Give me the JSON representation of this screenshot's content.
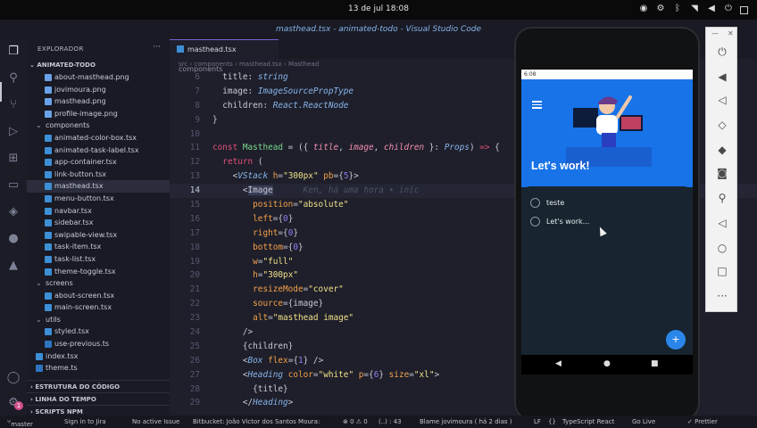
{
  "topbar": {
    "clock": "13 de jul 18:08"
  },
  "window_title": "masthead.tsx - animated-todo - Visual Studio Code",
  "sidebar": {
    "header": "EXPLORADOR",
    "more": "···",
    "project": "ANIMATED-TODO",
    "tree": [
      {
        "label": "about-masthead.png",
        "indent": 20,
        "icon": "png"
      },
      {
        "label": "jovimoura.png",
        "indent": 20,
        "icon": "png"
      },
      {
        "label": "masthead.png",
        "indent": 20,
        "icon": "png"
      },
      {
        "label": "profile-image.png",
        "indent": 20,
        "icon": "png"
      },
      {
        "label": "components",
        "indent": 10,
        "icon": "dir"
      },
      {
        "label": "animated-color-box.tsx",
        "indent": 20,
        "icon": "tsx"
      },
      {
        "label": "animated-task-label.tsx",
        "indent": 20,
        "icon": "tsx"
      },
      {
        "label": "app-container.tsx",
        "indent": 20,
        "icon": "tsx"
      },
      {
        "label": "link-button.tsx",
        "indent": 20,
        "icon": "tsx"
      },
      {
        "label": "masthead.tsx",
        "indent": 20,
        "icon": "tsx",
        "selected": true
      },
      {
        "label": "menu-button.tsx",
        "indent": 20,
        "icon": "tsx"
      },
      {
        "label": "navbar.tsx",
        "indent": 20,
        "icon": "tsx"
      },
      {
        "label": "sidebar.tsx",
        "indent": 20,
        "icon": "tsx"
      },
      {
        "label": "swipable-view.tsx",
        "indent": 20,
        "icon": "tsx"
      },
      {
        "label": "task-item.tsx",
        "indent": 20,
        "icon": "tsx"
      },
      {
        "label": "task-list.tsx",
        "indent": 20,
        "icon": "tsx"
      },
      {
        "label": "theme-toggle.tsx",
        "indent": 20,
        "icon": "tsx"
      },
      {
        "label": "screens",
        "indent": 10,
        "icon": "dir"
      },
      {
        "label": "about-screen.tsx",
        "indent": 20,
        "icon": "tsx"
      },
      {
        "label": "main-screen.tsx",
        "indent": 20,
        "icon": "tsx"
      },
      {
        "label": "utils",
        "indent": 10,
        "icon": "dir"
      },
      {
        "label": "styled.tsx",
        "indent": 20,
        "icon": "tsx"
      },
      {
        "label": "use-previous.ts",
        "indent": 20,
        "icon": "ts"
      },
      {
        "label": "index.tsx",
        "indent": 10,
        "icon": "tsx"
      },
      {
        "label": "theme.ts",
        "indent": 10,
        "icon": "ts"
      }
    ],
    "sections": [
      "ESTRUTURA DO CÓDIGO",
      "LINHA DO TEMPO",
      "SCRIPTS NPM"
    ]
  },
  "editor": {
    "tab_label": "masthead.tsx",
    "tab_path": "components",
    "breadcrumb": "src › components › masthead.tsx › Masthead",
    "current_line": 14,
    "lines": [
      {
        "n": 6,
        "tokens": [
          [
            "p",
            "  title: "
          ],
          [
            "t",
            "string"
          ]
        ]
      },
      {
        "n": 7,
        "tokens": [
          [
            "p",
            "  image: "
          ],
          [
            "t",
            "ImageSourcePropType"
          ]
        ]
      },
      {
        "n": 8,
        "tokens": [
          [
            "p",
            "  children: "
          ],
          [
            "t",
            "React.ReactNode"
          ]
        ]
      },
      {
        "n": 9,
        "tokens": [
          [
            "p",
            "}"
          ]
        ]
      },
      {
        "n": 10,
        "tokens": []
      },
      {
        "n": 11,
        "tokens": [
          [
            "k",
            "const "
          ],
          [
            "f",
            "Masthead"
          ],
          [
            "p",
            " = ({ "
          ],
          [
            "v",
            "title"
          ],
          [
            "p",
            ", "
          ],
          [
            "v",
            "image"
          ],
          [
            "p",
            ", "
          ],
          [
            "v",
            "children"
          ],
          [
            "p",
            " }: "
          ],
          [
            "t",
            "Props"
          ],
          [
            "p",
            ") "
          ],
          [
            "k",
            "=>"
          ],
          [
            "p",
            " {"
          ]
        ]
      },
      {
        "n": 12,
        "tokens": [
          [
            "p",
            "  "
          ],
          [
            "k",
            "return"
          ],
          [
            "p",
            " ("
          ]
        ]
      },
      {
        "n": 13,
        "tokens": [
          [
            "p",
            "    <"
          ],
          [
            "t",
            "VStack"
          ],
          [
            "p",
            " "
          ],
          [
            "a",
            "h"
          ],
          [
            "p",
            "="
          ],
          [
            "s",
            "\"300px\""
          ],
          [
            "p",
            " "
          ],
          [
            "a",
            "pb"
          ],
          [
            "p",
            "={"
          ],
          [
            "tg",
            "5"
          ],
          [
            "p",
            "}>"
          ]
        ]
      },
      {
        "n": 14,
        "tokens": [
          [
            "p",
            "      <"
          ],
          [
            "hl",
            "Image"
          ],
          [
            "ghost",
            "      Ken, há uma hora • inic"
          ]
        ]
      },
      {
        "n": 15,
        "tokens": [
          [
            "p",
            "        "
          ],
          [
            "a",
            "position"
          ],
          [
            "p",
            "="
          ],
          [
            "s",
            "\"absolute\""
          ]
        ]
      },
      {
        "n": 16,
        "tokens": [
          [
            "p",
            "        "
          ],
          [
            "a",
            "left"
          ],
          [
            "p",
            "={"
          ],
          [
            "tg",
            "0"
          ],
          [
            "p",
            "}"
          ]
        ]
      },
      {
        "n": 17,
        "tokens": [
          [
            "p",
            "        "
          ],
          [
            "a",
            "right"
          ],
          [
            "p",
            "={"
          ],
          [
            "tg",
            "0"
          ],
          [
            "p",
            "}"
          ]
        ]
      },
      {
        "n": 18,
        "tokens": [
          [
            "p",
            "        "
          ],
          [
            "a",
            "bottom"
          ],
          [
            "p",
            "={"
          ],
          [
            "tg",
            "0"
          ],
          [
            "p",
            "}"
          ]
        ]
      },
      {
        "n": 19,
        "tokens": [
          [
            "p",
            "        "
          ],
          [
            "a",
            "w"
          ],
          [
            "p",
            "="
          ],
          [
            "s",
            "\"full\""
          ]
        ]
      },
      {
        "n": 20,
        "tokens": [
          [
            "p",
            "        "
          ],
          [
            "a",
            "h"
          ],
          [
            "p",
            "="
          ],
          [
            "s",
            "\"300px\""
          ]
        ]
      },
      {
        "n": 21,
        "tokens": [
          [
            "p",
            "        "
          ],
          [
            "a",
            "resizeMode"
          ],
          [
            "p",
            "="
          ],
          [
            "s",
            "\"cover\""
          ]
        ]
      },
      {
        "n": 22,
        "tokens": [
          [
            "p",
            "        "
          ],
          [
            "a",
            "source"
          ],
          [
            "p",
            "={image}"
          ]
        ]
      },
      {
        "n": 23,
        "tokens": [
          [
            "p",
            "        "
          ],
          [
            "a",
            "alt"
          ],
          [
            "p",
            "="
          ],
          [
            "s",
            "\"masthead image\""
          ]
        ]
      },
      {
        "n": 24,
        "tokens": [
          [
            "p",
            "      />"
          ]
        ]
      },
      {
        "n": 25,
        "tokens": [
          [
            "p",
            "      {children}"
          ]
        ]
      },
      {
        "n": 26,
        "tokens": [
          [
            "p",
            "      <"
          ],
          [
            "t",
            "Box"
          ],
          [
            "p",
            " "
          ],
          [
            "a",
            "flex"
          ],
          [
            "p",
            "={"
          ],
          [
            "tg",
            "1"
          ],
          [
            "p",
            "} />"
          ]
        ]
      },
      {
        "n": 27,
        "tokens": [
          [
            "p",
            "      <"
          ],
          [
            "t",
            "Heading"
          ],
          [
            "p",
            " "
          ],
          [
            "a",
            "color"
          ],
          [
            "p",
            "="
          ],
          [
            "s",
            "\"white\""
          ],
          [
            "p",
            " "
          ],
          [
            "a",
            "p"
          ],
          [
            "p",
            "={"
          ],
          [
            "tg",
            "6"
          ],
          [
            "p",
            "} "
          ],
          [
            "a",
            "size"
          ],
          [
            "p",
            "="
          ],
          [
            "s",
            "\"xl\""
          ],
          [
            "p",
            ">"
          ]
        ]
      },
      {
        "n": 28,
        "tokens": [
          [
            "p",
            "        {title}"
          ]
        ]
      },
      {
        "n": 29,
        "tokens": [
          [
            "p",
            "      </"
          ],
          [
            "t",
            "Heading"
          ],
          [
            "p",
            ">"
          ]
        ]
      }
    ]
  },
  "status": {
    "branch": "master",
    "jira": "Sign in to Jira",
    "issue": "No active Issue",
    "bitbucket": "Bitbucket: João Victor dos Santos Moura:",
    "problems": "⊗ 0  ⚠ 0",
    "position": "(..) : 43",
    "blame": "Blame jovimoura ( há 2 dias )",
    "eol": "LF",
    "braces": "{}",
    "language": "TypeScript React",
    "golive": "Go Live",
    "prettier": "✓ Prettier"
  },
  "app": {
    "status_time": "6:08",
    "hero_title": "Let's work!",
    "tasks": [
      "teste",
      "Let's work..."
    ],
    "fab": "+"
  }
}
